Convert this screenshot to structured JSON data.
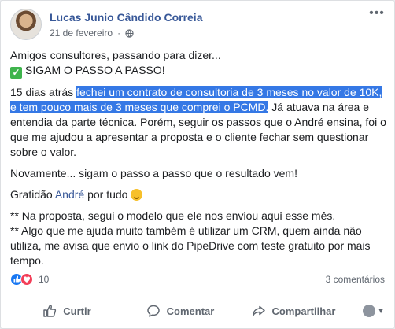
{
  "post": {
    "author": "Lucas Junio Cândido Correia",
    "date": "21 de fevereiro",
    "paragraphs": {
      "p1_line1": "Amigos consultores, passando para dizer...",
      "p1_line2": "SIGAM O PASSO A PASSO!",
      "p2_pre": "15 dias atrás ",
      "p2_highlight": "fechei um contrato de consultoria de 3 meses no valor de 10K, e tem pouco mais de 3 meses que comprei o PCMD.",
      "p2_post": " Já atuava na área e entendia da parte técnica. Porém, seguir os passos que o André ensina, foi o que me ajudou a apresentar a proposta e o cliente fechar sem questionar sobre o valor.",
      "p3": "Novamente... sigam o passo a passo que o resultado vem!",
      "p4_pre": "Gratidão ",
      "p4_link": "André",
      "p4_post": " por tudo",
      "p5_line1": "** Na proposta, segui o modelo que ele nos enviou aqui esse mês.",
      "p5_line2": "** Algo que me ajuda muito também é utilizar um CRM, quem ainda não utiliza, me avisa que envio o link do PipeDrive com teste gratuito por mais tempo."
    },
    "reactions_count": "10",
    "comments_label": "3 comentários"
  },
  "actions": {
    "like_label": "Curtir",
    "comment_label": "Comentar",
    "share_label": "Compartilhar"
  },
  "colors": {
    "link": "#385898",
    "highlight": "#3578e5",
    "like": "#1877f2",
    "love": "#f33e58"
  }
}
